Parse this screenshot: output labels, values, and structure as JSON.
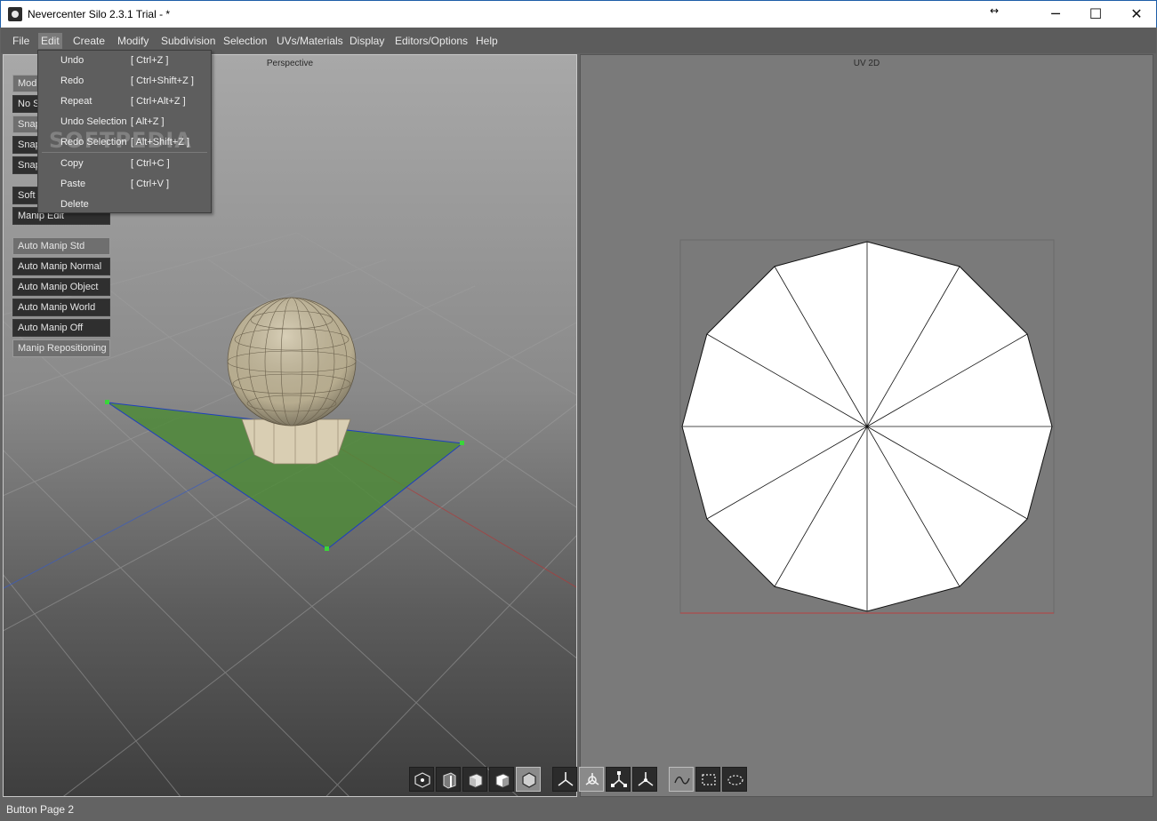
{
  "window": {
    "title": "Nevercenter Silo 2.3.1 Trial - *",
    "minimize": "─",
    "maximize": "☐",
    "close": "✕",
    "resize_glyph": "↔"
  },
  "menu": [
    "File",
    "Edit",
    "Create",
    "Modify",
    "Subdivision",
    "Selection",
    "UVs/Materials",
    "Display",
    "Editors/Options",
    "Help"
  ],
  "active_menu": "Edit",
  "edit_menu": [
    {
      "label": "Undo",
      "shortcut": "[ Ctrl+Z ]"
    },
    {
      "label": "Redo",
      "shortcut": "[ Ctrl+Shift+Z ]"
    },
    {
      "label": "Repeat",
      "shortcut": "[ Ctrl+Alt+Z ]"
    },
    {
      "label": "Undo Selection",
      "shortcut": "[ Alt+Z ]"
    },
    {
      "label": "Redo Selection",
      "shortcut": "[ Alt+Shift+Z ]"
    },
    {
      "label": "Copy",
      "shortcut": "[ Ctrl+C ]"
    },
    {
      "label": "Paste",
      "shortcut": "[ Ctrl+V ]"
    },
    {
      "label": "Delete",
      "shortcut": ""
    }
  ],
  "watermark": "SOFTPEDIA",
  "viewports": {
    "left": "Perspective",
    "right": "UV 2D"
  },
  "side_buttons": [
    "Mod",
    "No Sn",
    "Snap",
    "Snap",
    "Snap",
    "Soft S",
    "Manip Edit",
    "Auto Manip Std",
    "Auto Manip Normal",
    "Auto Manip Object",
    "Auto Manip World",
    "Auto Manip Off",
    "Manip Repositioning"
  ],
  "toolbar_icons": [
    "vertex-mode-icon",
    "edge-mode-icon",
    "face-mode-icon",
    "object-mode-icon",
    "multi-mode-icon",
    "move-manip-icon",
    "rotate-manip-icon",
    "scale-manip-icon",
    "universal-manip-icon",
    "lasso-select-icon",
    "rect-select-icon",
    "paint-select-icon"
  ],
  "status": "Button Page 2",
  "colors": {
    "menubar": "#5c5c5c",
    "button_dark": "#2f2f2f",
    "button_light": "#6f6f6f",
    "selection_fill": "#4f8a3a",
    "selection_edge": "#1e3fbf",
    "uv_fill": "#ffffff"
  }
}
